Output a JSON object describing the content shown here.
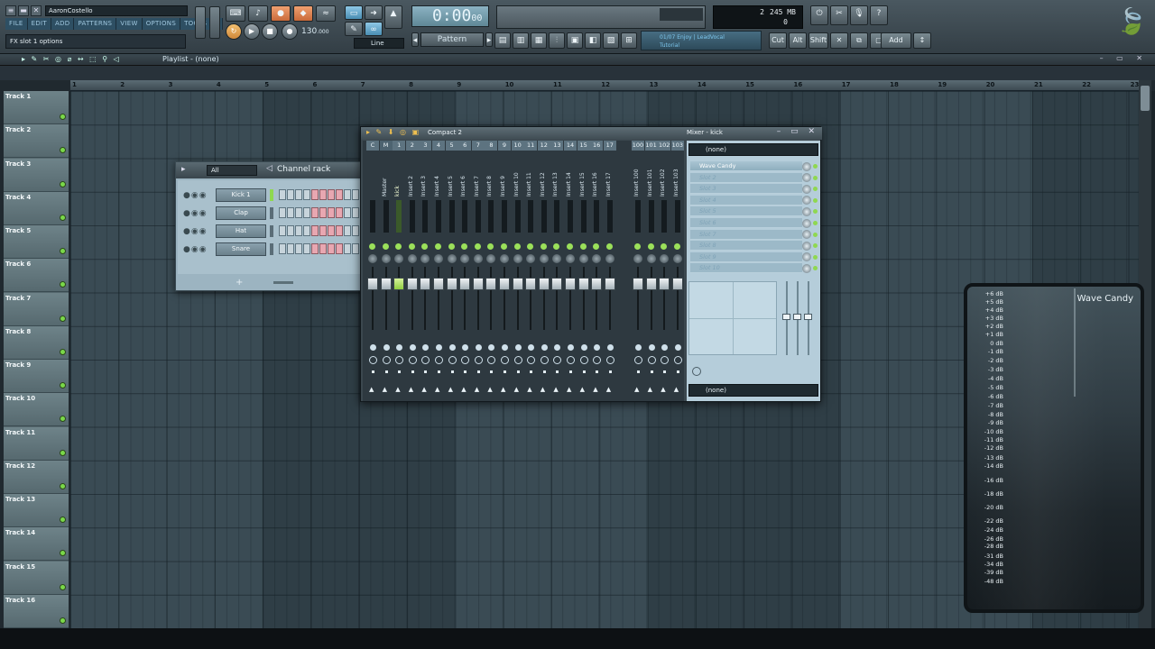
{
  "topbar": {
    "user": "AaronCostello",
    "menu": [
      "FILE",
      "EDIT",
      "ADD",
      "PATTERNS",
      "VIEW",
      "OPTIONS",
      "TOOLS",
      "?"
    ],
    "hint": "FX slot 1 options",
    "time": "0:00",
    "time_small": "00",
    "bpm": "130",
    "bpm_frac": ".000",
    "pattern_label": "Pattern",
    "snap_mode": "Line",
    "cpu_poly": "2",
    "memory": "245 MB",
    "cpu_zero": "0",
    "hint_panel_line1": "01/07 Enjoy | LeadVocal",
    "hint_panel_line2": "Tutorial",
    "tool_buttons": [
      "Cut",
      "Alt",
      "Shift",
      "Add"
    ]
  },
  "playlist": {
    "title": "Playlist - (none)",
    "ruler": [
      "1",
      "2",
      "3",
      "4",
      "5",
      "6",
      "7",
      "8",
      "9",
      "10",
      "11",
      "12",
      "13",
      "14",
      "15",
      "16",
      "17",
      "18",
      "19",
      "20",
      "21",
      "22",
      "23"
    ],
    "tracks": [
      "Track 1",
      "Track 2",
      "Track 3",
      "Track 4",
      "Track 5",
      "Track 6",
      "Track 7",
      "Track 8",
      "Track 9",
      "Track 10",
      "Track 11",
      "Track 12",
      "Track 13",
      "Track 14",
      "Track 15",
      "Track 16"
    ]
  },
  "channel_rack": {
    "filter": "All",
    "title": "Channel rack",
    "channels": [
      "Kick 1",
      "Clap",
      "Hat",
      "Snare"
    ],
    "add_label": "+"
  },
  "mixer": {
    "preset": "Compact 2",
    "title": "Mixer - kick",
    "strip_numbers": [
      "C",
      "M",
      "1",
      "2",
      "3",
      "4",
      "5",
      "6",
      "7",
      "8",
      "9",
      "10",
      "11",
      "12",
      "13",
      "14",
      "15",
      "16",
      "17"
    ],
    "strip_names": [
      "",
      "Master",
      "kick",
      "Insert 2",
      "Insert 3",
      "Insert 4",
      "Insert 5",
      "Insert 6",
      "Insert 7",
      "Insert 8",
      "Insert 9",
      "Insert 10",
      "Insert 11",
      "Insert 12",
      "Insert 13",
      "Insert 14",
      "Insert 15",
      "Insert 16",
      "Insert 17"
    ],
    "extra_numbers": [
      "100",
      "101",
      "102",
      "103"
    ],
    "extra_names": [
      "Insert 100",
      "Insert 101",
      "Insert 102",
      "Insert 103"
    ],
    "input_select": "(none)",
    "output_select": "(none)",
    "slots": [
      "Wave Candy",
      "Slot 2",
      "Slot 3",
      "Slot 4",
      "Slot 5",
      "Slot 6",
      "Slot 7",
      "Slot 8",
      "Slot 9",
      "Slot 10"
    ]
  },
  "wave_candy": {
    "title": "Wave Candy",
    "db_labels": [
      "+6 dB",
      "+5 dB",
      "+4 dB",
      "+3 dB",
      "+2 dB",
      "+1 dB",
      "0 dB",
      "-1 dB",
      "-2 dB",
      "-3 dB",
      "-4 dB",
      "-5 dB",
      "-6 dB",
      "-7 dB",
      "-8 dB",
      "-9 dB",
      "-10 dB",
      "-11 dB",
      "-12 dB",
      "-13 dB",
      "-14 dB",
      "-16 dB",
      "-18 dB",
      "-20 dB",
      "-22 dB",
      "-24 dB",
      "-26 dB",
      "-28 dB",
      "-31 dB",
      "-34 dB",
      "-39 dB",
      "-48 dB"
    ]
  },
  "colors": {
    "accent_green": "#8fd850",
    "step_pink": "#e8a7b1",
    "grid": "#3a4b54"
  }
}
